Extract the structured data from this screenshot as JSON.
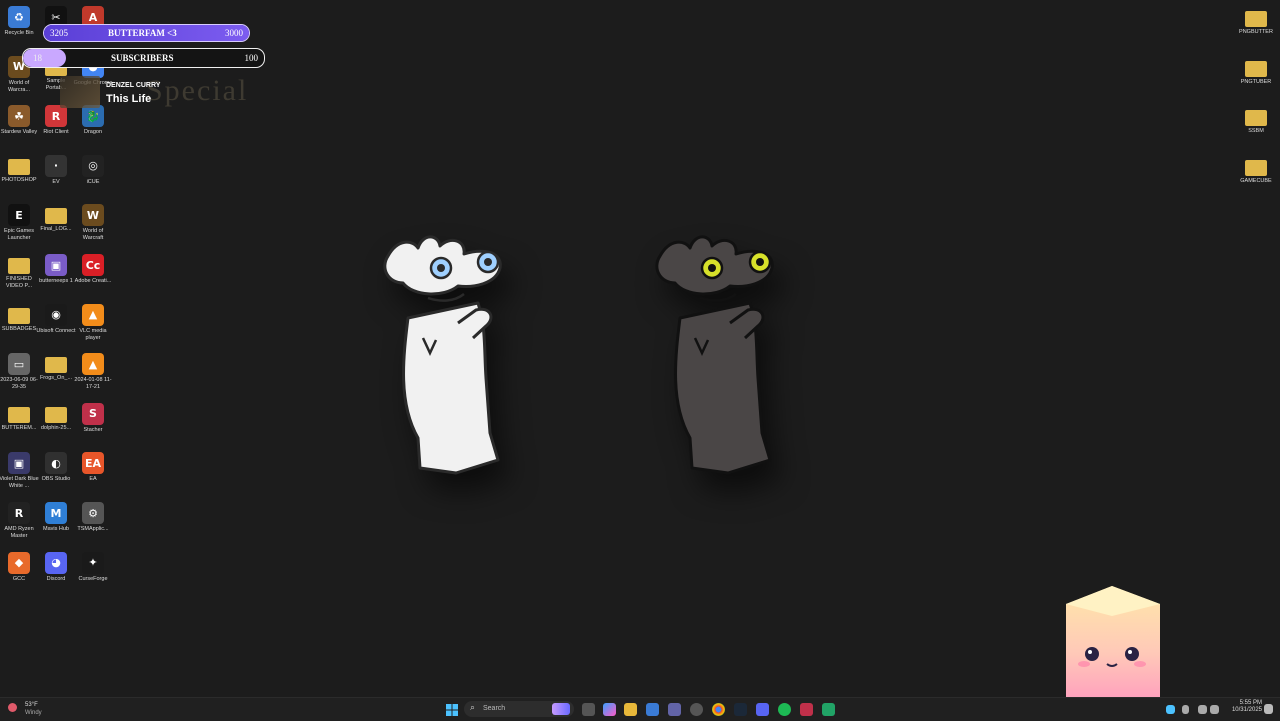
{
  "desktop_left": [
    {
      "label": "Recycle Bin",
      "icon": "recycle-bin-icon",
      "color": "#3a7bd5",
      "glyph": "♻"
    },
    {
      "label": "",
      "icon": "capcut-icon",
      "color": "#111",
      "glyph": "✂"
    },
    {
      "label": "",
      "icon": "app-a-icon",
      "color": "#c0392b",
      "glyph": "A"
    },
    {
      "label": "World of Warcra...",
      "icon": "world-of-warcraft-icon",
      "color": "#6b4b1e",
      "glyph": "W"
    },
    {
      "label": "Sample Portab...",
      "icon": "folder-icon",
      "color": "#e0b84b",
      "glyph": ""
    },
    {
      "label": "Google Chrome",
      "icon": "chrome-icon",
      "color": "#4285f4",
      "glyph": "●"
    },
    {
      "label": "Stardew Valley",
      "icon": "stardew-valley-icon",
      "color": "#8a5a2b",
      "glyph": "☘"
    },
    {
      "label": "Riot Client",
      "icon": "riot-client-icon",
      "color": "#d13639",
      "glyph": "R"
    },
    {
      "label": "Dragon",
      "icon": "dragon-icon",
      "color": "#2b6cb0",
      "glyph": "🐉"
    },
    {
      "label": "PHOTOSHOP",
      "icon": "folder-icon",
      "color": "#e0b84b",
      "glyph": ""
    },
    {
      "label": "EV",
      "icon": "ev-icon",
      "color": "#333",
      "glyph": "·"
    },
    {
      "label": "iCUE",
      "icon": "icue-icon",
      "color": "#222",
      "glyph": "◎"
    },
    {
      "label": "Epic Games Launcher",
      "icon": "epic-games-icon",
      "color": "#111",
      "glyph": "E"
    },
    {
      "label": "Final_LOG...",
      "icon": "folder-icon",
      "color": "#e0b84b",
      "glyph": ""
    },
    {
      "label": "World of Warcraft",
      "icon": "world-of-warcraft-icon",
      "color": "#6b4b1e",
      "glyph": "W"
    },
    {
      "label": "FINISHED VIDEO P...",
      "icon": "folder-icon",
      "color": "#e0b84b",
      "glyph": ""
    },
    {
      "label": "butterneeps 1",
      "icon": "image-file-icon",
      "color": "#7a5cc7",
      "glyph": "▣"
    },
    {
      "label": "Adobe Creati...",
      "icon": "adobe-cc-icon",
      "color": "#da1f26",
      "glyph": "Cc"
    },
    {
      "label": "SUBBADGES",
      "icon": "folder-icon",
      "color": "#e0b84b",
      "glyph": ""
    },
    {
      "label": "Ubisoft Connect",
      "icon": "ubisoft-icon",
      "color": "#1a1a1a",
      "glyph": "◉"
    },
    {
      "label": "VLC media player",
      "icon": "vlc-icon",
      "color": "#f28c1a",
      "glyph": "▲"
    },
    {
      "label": "2023-06-09 06-29-35",
      "icon": "video-file-icon",
      "color": "#666",
      "glyph": "▭"
    },
    {
      "label": "Frogs_On_...",
      "icon": "folder-icon",
      "color": "#e0b84b",
      "glyph": ""
    },
    {
      "label": "2024-01-08 11-17-21",
      "icon": "vlc-icon",
      "color": "#f28c1a",
      "glyph": "▲"
    },
    {
      "label": "BUTTEREM...",
      "icon": "folder-icon",
      "color": "#e0b84b",
      "glyph": ""
    },
    {
      "label": "dolphin-25...",
      "icon": "folder-icon",
      "color": "#e0b84b",
      "glyph": ""
    },
    {
      "label": "Stacher",
      "icon": "stacher-icon",
      "color": "#c0304a",
      "glyph": "S"
    },
    {
      "label": "Violet Dark Blue White ...",
      "icon": "image-file-icon",
      "color": "#3a3a6a",
      "glyph": "▣"
    },
    {
      "label": "OBS Studio",
      "icon": "obs-icon",
      "color": "#303030",
      "glyph": "◐"
    },
    {
      "label": "EA",
      "icon": "ea-icon",
      "color": "#e8562a",
      "glyph": "EA"
    },
    {
      "label": "AMD Ryzen Master",
      "icon": "amd-ryzen-icon",
      "color": "#222",
      "glyph": "R"
    },
    {
      "label": "Mavis Hub",
      "icon": "mavis-hub-icon",
      "color": "#2f7fd6",
      "glyph": "M"
    },
    {
      "label": "TSMApplic...",
      "icon": "gear-icon",
      "color": "#555",
      "glyph": "⚙"
    },
    {
      "label": "GCC",
      "icon": "gcc-icon",
      "color": "#e86a2b",
      "glyph": "◆"
    },
    {
      "label": "Discord",
      "icon": "discord-icon",
      "color": "#5865f2",
      "glyph": "◕"
    },
    {
      "label": "CurseForge",
      "icon": "curseforge-icon",
      "color": "#1a1a1a",
      "glyph": "✦"
    }
  ],
  "desktop_right": [
    {
      "label": "PNGBUTTER",
      "icon": "folder-icon"
    },
    {
      "label": "PNGTUBER",
      "icon": "folder-icon"
    },
    {
      "label": "SSBM",
      "icon": "folder-icon"
    },
    {
      "label": "GAMECUBE",
      "icon": "folder-icon"
    }
  ],
  "overlay": {
    "follower_goal": {
      "current": "3205",
      "label": "BUTTERFAM <3",
      "target": "3000",
      "progress": 1.0
    },
    "sub_goal": {
      "current": "18",
      "label": "SUBSCRIBERS",
      "target": "100",
      "progress": 0.18
    },
    "now_playing": {
      "artist": "DENZEL CURRY",
      "song": "This Life",
      "tag": "Special"
    }
  },
  "taskbar": {
    "weather_temp": "53°F",
    "weather_cond": "Windy",
    "search_placeholder": "Search",
    "time": "5:55 PM",
    "date": "10/31/2025"
  },
  "colors": {
    "desktop_bg": "#1c1c1c",
    "goal_fill": "#6a4be0",
    "sub_fill": "#c9a8ff",
    "folder": "#e0b84b"
  }
}
